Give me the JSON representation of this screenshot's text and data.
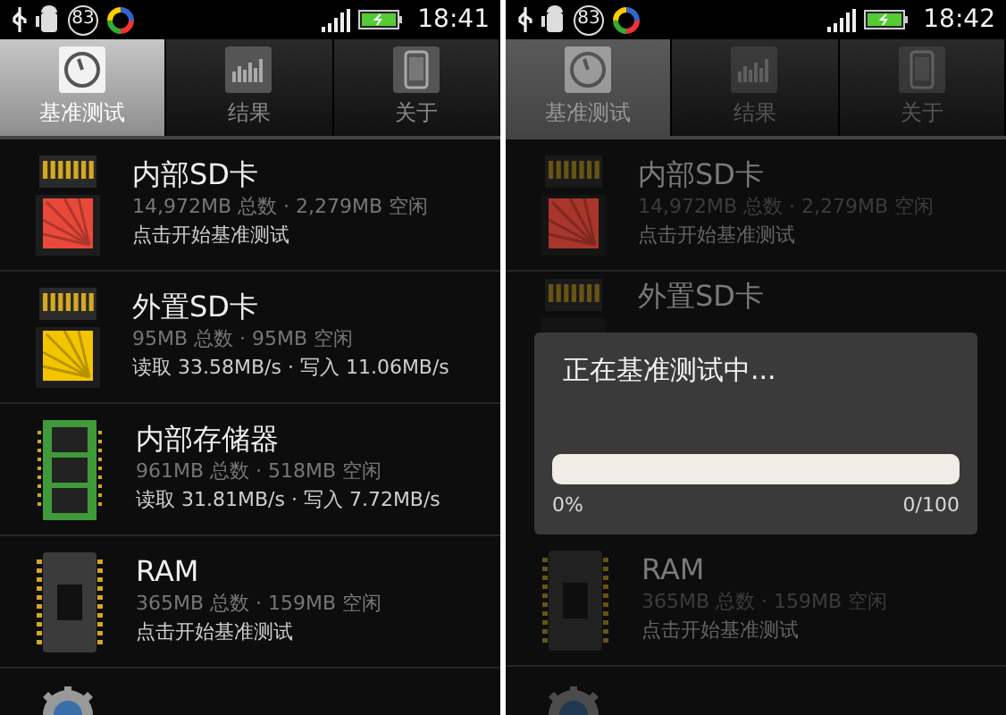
{
  "screens": [
    {
      "status_bar": {
        "badge": "83",
        "time": "18:41"
      },
      "tabs": [
        {
          "label": "基准测试",
          "kind": "gauge",
          "selected": true
        },
        {
          "label": "结果",
          "kind": "chart",
          "selected": false
        },
        {
          "label": "关于",
          "kind": "phone",
          "selected": false
        }
      ],
      "items": [
        {
          "kind": "sd-card",
          "color": "#e8493a",
          "title": "内部SD卡",
          "details": "14,972MB 总数 · 2,279MB 空闲",
          "result": "点击开始基准测试"
        },
        {
          "kind": "sd-card",
          "color": "#f5c400",
          "title": "外置SD卡",
          "details": "95MB 总数 · 95MB 空闲",
          "result": "读取 33.58MB/s · 写入 11.06MB/s"
        },
        {
          "kind": "memory",
          "title": "内部存储器",
          "details": "961MB 总数 · 518MB 空闲",
          "result": "读取 31.81MB/s · 写入 7.72MB/s"
        },
        {
          "kind": "ram",
          "title": "RAM",
          "details": "365MB 总数 · 159MB 空闲",
          "result": "点击开始基准测试"
        },
        {
          "kind": "settings"
        }
      ]
    },
    {
      "status_bar": {
        "badge": "83",
        "time": "18:42"
      },
      "tabs": [
        {
          "label": "基准测试",
          "kind": "gauge",
          "selected": true
        },
        {
          "label": "结果",
          "kind": "chart",
          "selected": false
        },
        {
          "label": "关于",
          "kind": "phone",
          "selected": false
        }
      ],
      "items_above": [
        {
          "kind": "sd-card",
          "color": "#a8362c",
          "title": "内部SD卡",
          "details": "14,972MB 总数 · 2,279MB 空闲",
          "result": "点击开始基准测试"
        },
        {
          "kind": "sd-card",
          "title": "外置SD卡"
        }
      ],
      "dialog": {
        "title": "正在基准测试中...",
        "level": 0,
        "percent": "0%",
        "count": "0/100"
      },
      "items_below": [
        {
          "kind": "ram",
          "title": "RAM",
          "details": "365MB 总数 · 159MB 空闲",
          "result": "点击开始基准测试"
        },
        {
          "kind": "settings"
        }
      ]
    }
  ]
}
